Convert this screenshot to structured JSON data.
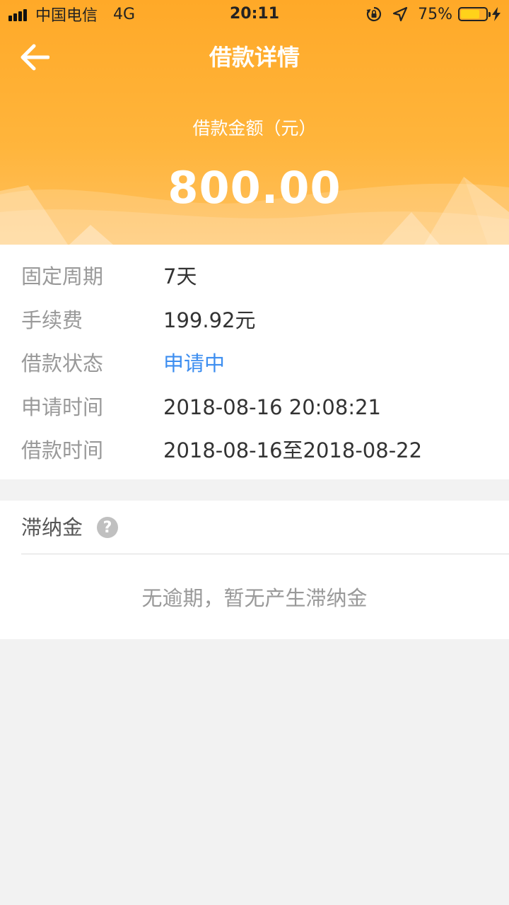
{
  "status_bar": {
    "carrier": "中国电信",
    "network": "4G",
    "time": "20:11",
    "battery_percent": "75%",
    "battery_level": 0.75,
    "icons": [
      "signal-icon",
      "orientation-lock-icon",
      "location-arrow-icon",
      "battery-icon",
      "charging-bolt-icon"
    ]
  },
  "nav": {
    "title": "借款详情",
    "back_icon": "back-arrow-icon"
  },
  "summary": {
    "amount_label": "借款金额（元）",
    "amount": "800.00"
  },
  "details": [
    {
      "label": "固定周期",
      "value": "7天"
    },
    {
      "label": "手续费",
      "value": "199.92元"
    },
    {
      "label": "借款状态",
      "value": "申请中"
    },
    {
      "label": "申请时间",
      "value": "2018-08-16 20:08:21"
    },
    {
      "label": "借款时间",
      "value": "2018-08-16至2018-08-22"
    }
  ],
  "late_fee": {
    "title": "滞纳金",
    "help_icon": "question-mark-icon",
    "help_glyph": "?",
    "empty_text": "无逾期，暂无产生滞纳金"
  },
  "colors": {
    "header_orange": "#ffa928",
    "status_blue": "#3d8ef0",
    "label_gray": "#999999",
    "value_dark": "#333333",
    "page_bg": "#f2f2f2",
    "battery_yellow": "#ffd21a"
  }
}
